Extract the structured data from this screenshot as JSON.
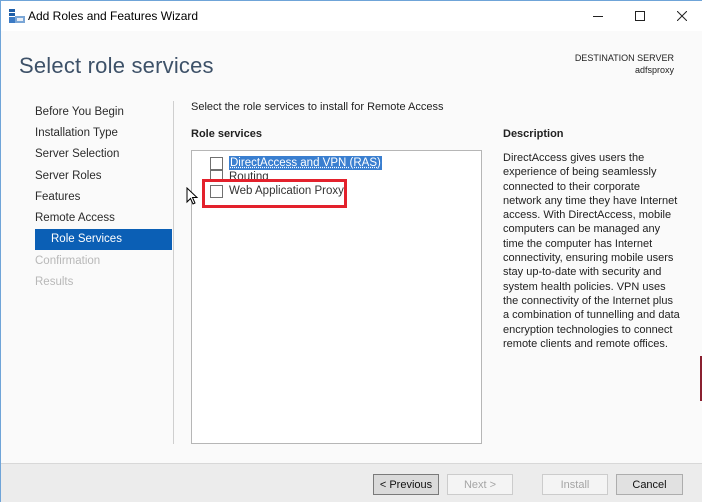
{
  "window": {
    "title": "Add Roles and Features Wizard",
    "controls": {
      "minimize": "minimize",
      "maximize": "maximize",
      "close": "close"
    }
  },
  "header": {
    "page_title": "Select role services",
    "destination_label": "DESTINATION SERVER",
    "destination_value": "adfsproxy"
  },
  "nav": {
    "items": [
      {
        "label": "Before You Begin",
        "state": "normal"
      },
      {
        "label": "Installation Type",
        "state": "normal"
      },
      {
        "label": "Server Selection",
        "state": "normal"
      },
      {
        "label": "Server Roles",
        "state": "normal"
      },
      {
        "label": "Features",
        "state": "normal"
      },
      {
        "label": "Remote Access",
        "state": "normal"
      },
      {
        "label": "Role Services",
        "state": "active"
      },
      {
        "label": "Confirmation",
        "state": "disabled"
      },
      {
        "label": "Results",
        "state": "disabled"
      }
    ]
  },
  "main": {
    "instruction": "Select the role services to install for Remote Access",
    "role_services_heading": "Role services",
    "role_services": [
      {
        "label": "DirectAccess and VPN (RAS)",
        "checked": false,
        "selected": true
      },
      {
        "label": "Routing",
        "checked": false,
        "selected": false
      },
      {
        "label": "Web Application Proxy",
        "checked": false,
        "selected": false,
        "highlighted": true
      }
    ],
    "highlight_color": "#e3212c"
  },
  "description": {
    "heading": "Description",
    "text": "DirectAccess gives users the experience of being seamlessly connected to their corporate network any time they have Internet access. With DirectAccess, mobile computers can be managed any time the computer has Internet connectivity, ensuring mobile users stay up-to-date with security and system health policies. VPN uses the connectivity of the Internet plus a combination of tunnelling and data encryption technologies to connect remote clients and remote offices."
  },
  "footer": {
    "previous_label": "< Previous",
    "next_label": "Next >",
    "install_label": "Install",
    "cancel_label": "Cancel"
  },
  "colors": {
    "accent": "#0b5fb5",
    "title_text": "#3d5168",
    "selection": "#3a7fd0"
  }
}
